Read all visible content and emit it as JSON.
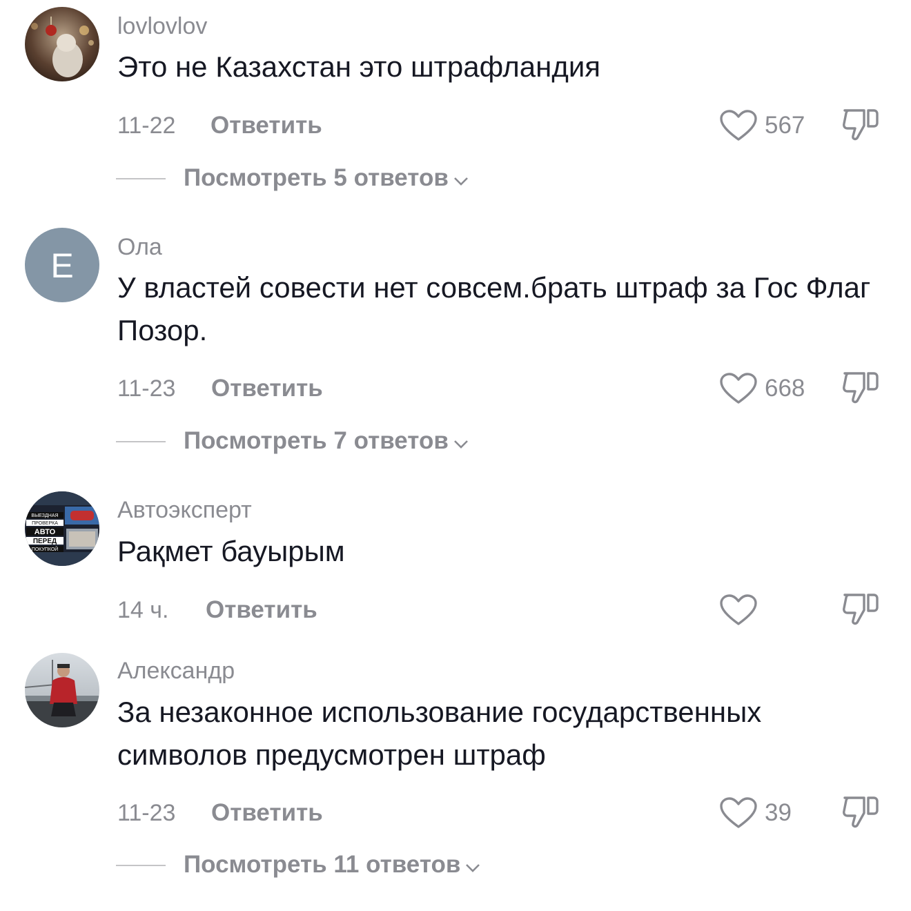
{
  "comments": [
    {
      "username": "lovlovlov",
      "text": "Это не Казахстан это штрафландия",
      "date": "11-22",
      "reply_label": "Ответить",
      "likes": "567",
      "view_replies": "Посмотреть 5 ответов"
    },
    {
      "username": "Ола",
      "avatar_letter": "Е",
      "avatar_color": "#8496a6",
      "text": "У властей совести нет совсем.брать штраф за Гос Флаг Позор.",
      "date": "11-23",
      "reply_label": "Ответить",
      "likes": "668",
      "view_replies": "Посмотреть 7 ответов"
    },
    {
      "username": "Автоэксперт",
      "avatar_lines": [
        "ВЫЕЗДНАЯ",
        "ПРОВЕРКА",
        "АВТО",
        "ПЕРЕД",
        "ПОКУПКОЙ"
      ],
      "text": "Рақмет бауырым",
      "date": "14 ч.",
      "reply_label": "Ответить"
    },
    {
      "username": "Александр",
      "text": "За незаконное использование государственных символов предусмотрен штраф",
      "date": "11-23",
      "reply_label": "Ответить",
      "likes": "39",
      "view_replies": "Посмотреть 11 ответов"
    }
  ],
  "icons": {
    "like": "heart-outline-icon",
    "dislike": "thumbs-down-outline-icon",
    "expand": "chevron-down-icon"
  },
  "colors": {
    "text": "#161823",
    "muted": "#8a8b91",
    "divider": "#c4c4c6"
  }
}
